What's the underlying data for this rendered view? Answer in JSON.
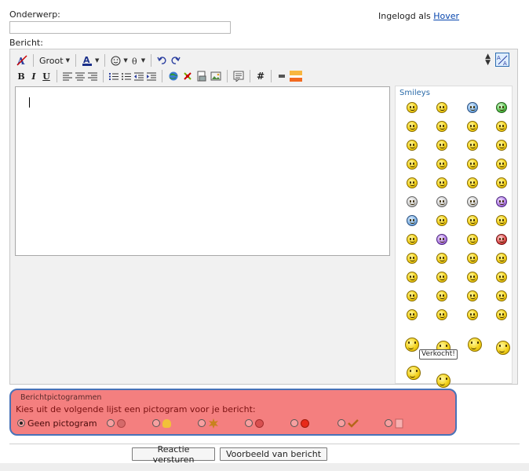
{
  "form": {
    "subject_label": "Onderwerp:",
    "subject_value": "",
    "message_label": "Bericht:",
    "login_prefix": "Ingelogd als",
    "login_user": "Hover"
  },
  "toolbar": {
    "font_size": "Groot",
    "row2_buttons": [
      "B",
      "I",
      "U"
    ],
    "hash_label": "#"
  },
  "smileys": {
    "title": "Smileys",
    "tooltip": "Verkocht!"
  },
  "pictograms": {
    "legend": "Berichtpictogrammen",
    "question": "Kies uit de volgende lijst een pictogram voor je bericht:",
    "none_label": "Geen pictogram"
  },
  "buttons": {
    "submit": "Reactie versturen",
    "preview": "Voorbeeld van bericht"
  },
  "colors": {
    "picto_bg": "#f47f7f",
    "picto_border": "#4872b8",
    "link": "#0645ad"
  }
}
